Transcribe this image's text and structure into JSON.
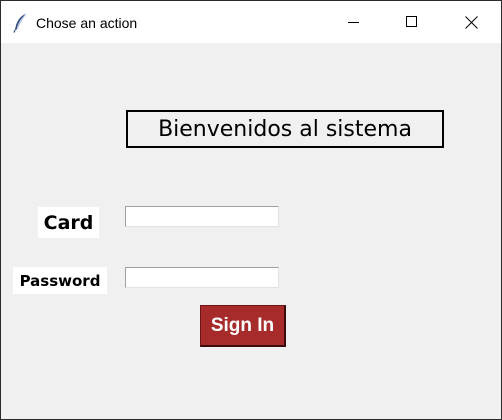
{
  "window": {
    "title": "Chose an action",
    "icon": "feather-icon",
    "controls": {
      "minimize": "minimize-icon",
      "maximize": "maximize-icon",
      "close": "close-icon"
    }
  },
  "main": {
    "heading": "Bienvenidos al sistema",
    "card_label": "Card",
    "card_value": "",
    "password_label": "Password",
    "password_value": "",
    "signin_label": "Sign In"
  },
  "colors": {
    "window_bg": "#f0f0f0",
    "titlebar_bg": "#ffffff",
    "button_bg": "#a82b2b",
    "button_text": "#ffffff"
  }
}
